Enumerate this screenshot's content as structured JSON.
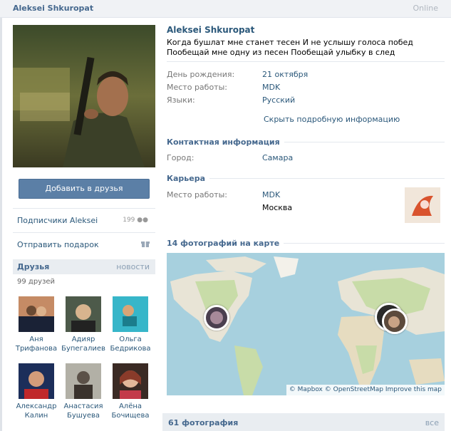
{
  "topbar": {
    "name": "Aleksei Shkuropat",
    "status": "Online"
  },
  "profile": {
    "name": "Aleksei Shkuropat",
    "status_text": "Когда бушлат мне станет тесен И не услышу голоса побед Пообещай мне одну из песен Пообещай улыбку в след"
  },
  "actions": {
    "add_friend": "Добавить в друзья",
    "followers": "Подписчики Aleksei",
    "followers_count": "199",
    "send_gift": "Отправить подарок"
  },
  "info": {
    "birthday_label": "День рождения:",
    "birthday_value": "21 октября",
    "work_label": "Место работы:",
    "work_value": "MDK",
    "languages_label": "Языки:",
    "languages_value": "Русский",
    "hide_link": "Скрыть подробную информацию"
  },
  "contact": {
    "heading": "Контактная информация",
    "city_label": "Город:",
    "city_value": "Самара"
  },
  "career": {
    "heading": "Карьера",
    "work_label": "Место работы:",
    "work_value": "MDK",
    "work_city": "Москва"
  },
  "map": {
    "heading": "14 фотографий на карте",
    "attribution": "© Mapbox © OpenStreetMap Improve this map"
  },
  "friends": {
    "heading": "Друзья",
    "news_link": "новости",
    "count_text": "99 друзей",
    "items": [
      {
        "first": "Аня",
        "last": "Трифанова"
      },
      {
        "first": "Адияр",
        "last": "Бупегалиев"
      },
      {
        "first": "Ольга",
        "last": "Бедрикова"
      },
      {
        "first": "Александр",
        "last": "Калин"
      },
      {
        "first": "Анастасия",
        "last": "Бушуева"
      },
      {
        "first": "Алёна",
        "last": "Бочищева"
      }
    ]
  },
  "photos": {
    "heading": "61 фотография",
    "all_link": "все"
  },
  "colors": {
    "link": "#2b587a",
    "header": "#45688e",
    "button": "#5b7fa6",
    "map_water": "#a7d0de"
  }
}
